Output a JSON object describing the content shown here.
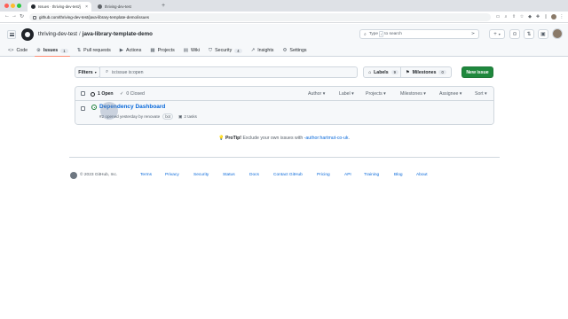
{
  "browser": {
    "tabs": [
      {
        "title": "Issues · thriving-dev-test/j",
        "active": true
      },
      {
        "title": "thriving-dev-test",
        "active": false
      }
    ],
    "url": "github.com/thriving-dev-test/java-library-template-demo/issues"
  },
  "header": {
    "owner": "thriving-dev-test",
    "separator": "/",
    "repo": "java-library-template-demo",
    "search_prefix": "Type",
    "search_key": "/",
    "search_suffix": "to search",
    "plus_label": "+",
    "caret": "▾"
  },
  "repo_nav": [
    {
      "label": "Code",
      "icon": "<>"
    },
    {
      "label": "Issues",
      "icon": "⊙",
      "count": "1",
      "active": true
    },
    {
      "label": "Pull requests",
      "icon": "⇅"
    },
    {
      "label": "Actions",
      "icon": "▶"
    },
    {
      "label": "Projects",
      "icon": "▦"
    },
    {
      "label": "Wiki",
      "icon": "▤"
    },
    {
      "label": "Security",
      "icon": "⛉",
      "count": "4"
    },
    {
      "label": "Insights",
      "icon": "↗"
    },
    {
      "label": "Settings",
      "icon": "⚙"
    }
  ],
  "filter_bar": {
    "filters_label": "Filters",
    "filters_caret": "▾",
    "query": "is:issue is:open",
    "labels_label": "Labels",
    "labels_count": "9",
    "milestones_label": "Milestones",
    "milestones_count": "0",
    "new_issue_label": "New issue"
  },
  "issues_header": {
    "open_label": "1 Open",
    "closed_label": "0 Closed",
    "filters": [
      "Author ▾",
      "Label ▾",
      "Projects ▾",
      "Milestones ▾",
      "Assignee ▾",
      "Sort ▾"
    ]
  },
  "issues": [
    {
      "title": "Dependency Dashboard",
      "meta": "#2 opened yesterday by renovate",
      "bot_label": "bot",
      "tasks": "2 tasks"
    }
  ],
  "protip": {
    "prefix": "ProTip!",
    "text": " Exclude your own issues with ",
    "link": "-author:hartmut-co-uk",
    "suffix": "."
  },
  "footer": {
    "copyright": "© 2023 GitHub, Inc.",
    "links": [
      "Terms",
      "Privacy",
      "Security",
      "Status",
      "Docs",
      "Contact GitHub",
      "Pricing",
      "API",
      "Training",
      "Blog",
      "About"
    ]
  },
  "colors": {
    "accent": "#0969da",
    "primary_button": "#1f883d",
    "open_issue": "#1a7f37",
    "active_tab_underline": "#fd8c73"
  }
}
